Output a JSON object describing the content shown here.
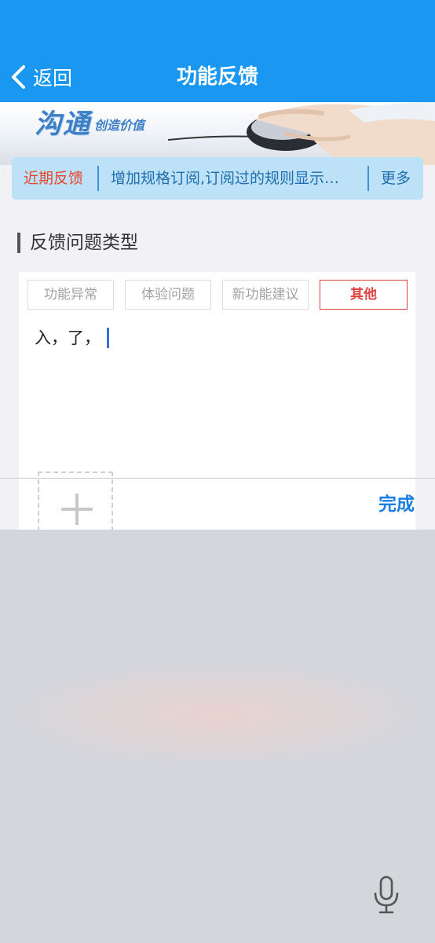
{
  "header": {
    "back_label": "返回",
    "title": "功能反馈",
    "color": "#1a97f0"
  },
  "banner": {
    "logo_text": "沟通",
    "slogan": "创造价值"
  },
  "recent": {
    "label": "近期反馈",
    "text": "增加规格订阅,订阅过的规则显示…",
    "more": "更多"
  },
  "section": {
    "title": "反馈问题类型"
  },
  "feedback_types": [
    {
      "label": "功能异常",
      "selected": false
    },
    {
      "label": "体验问题",
      "selected": false
    },
    {
      "label": "新功能建议",
      "selected": false
    },
    {
      "label": "其他",
      "selected": true
    }
  ],
  "input": {
    "value": "入，了，"
  },
  "toolbar": {
    "done_label": "完成"
  },
  "icons": {
    "back": "chevron-left-icon",
    "add_photo": "plus-icon",
    "mic": "microphone-icon"
  }
}
